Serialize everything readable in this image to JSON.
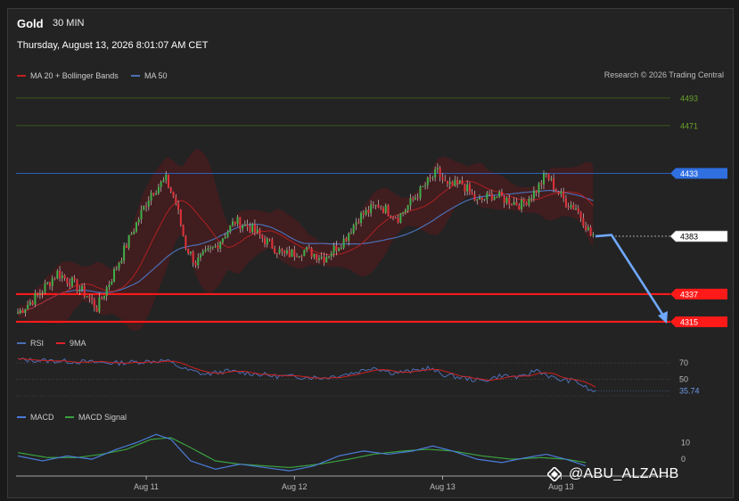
{
  "header": {
    "symbol": "Gold",
    "timeframe": "30 MIN",
    "datetime": "Thursday, August 13, 2026 8:01:07 AM CET"
  },
  "legend": {
    "ma20_bb": "MA 20 + Bollinger Bands",
    "ma50": "MA 50",
    "rsi": "RSI",
    "rsi_ma": "9MA",
    "macd": "MACD",
    "macd_signal": "MACD Signal"
  },
  "research": "Research © 2026 Trading Central",
  "watermark": "@ABU_ALZAHB",
  "colors": {
    "up": "#3fae49",
    "down": "#e0323b",
    "ma50": "#4a6fb5",
    "ma20": "#b02020",
    "rsi": "#4a6fb5",
    "macd": "#4a7cd9",
    "signal": "#3aa040",
    "support": "#ff1a1a",
    "resistance_blue": "#2f6fe0",
    "resistance_green": "#5a9a2a"
  },
  "chart_data": {
    "type": "candlestick",
    "price_axis_labels": [
      "4493",
      "4471",
      "4433",
      "4383",
      "4337",
      "4315"
    ],
    "levels": [
      {
        "value": 4493,
        "label": "4493",
        "kind": "resistance-green"
      },
      {
        "value": 4471,
        "label": "4471",
        "kind": "resistance-green"
      },
      {
        "value": 4433,
        "label": "4433",
        "kind": "resistance-blue"
      },
      {
        "value": 4383,
        "label": "4383",
        "kind": "current"
      },
      {
        "value": 4337,
        "label": "4337",
        "kind": "support"
      },
      {
        "value": 4315,
        "label": "4315",
        "kind": "support"
      }
    ],
    "price_range": [
      4310,
      4500
    ],
    "price_keypoints": [
      [
        0,
        4322
      ],
      [
        8,
        4336
      ],
      [
        16,
        4354
      ],
      [
        22,
        4346
      ],
      [
        28,
        4336
      ],
      [
        32,
        4326
      ],
      [
        38,
        4350
      ],
      [
        46,
        4385
      ],
      [
        54,
        4418
      ],
      [
        60,
        4428
      ],
      [
        64,
        4410
      ],
      [
        68,
        4375
      ],
      [
        72,
        4362
      ],
      [
        80,
        4375
      ],
      [
        88,
        4395
      ],
      [
        94,
        4390
      ],
      [
        100,
        4380
      ],
      [
        108,
        4368
      ],
      [
        116,
        4372
      ],
      [
        124,
        4366
      ],
      [
        132,
        4380
      ],
      [
        138,
        4398
      ],
      [
        146,
        4408
      ],
      [
        154,
        4398
      ],
      [
        160,
        4412
      ],
      [
        166,
        4426
      ],
      [
        170,
        4434
      ],
      [
        174,
        4422
      ],
      [
        180,
        4425
      ],
      [
        186,
        4410
      ],
      [
        192,
        4416
      ],
      [
        198,
        4412
      ],
      [
        204,
        4408
      ],
      [
        210,
        4420
      ],
      [
        214,
        4432
      ],
      [
        218,
        4420
      ],
      [
        222,
        4410
      ],
      [
        226,
        4406
      ],
      [
        230,
        4392
      ],
      [
        232,
        4384
      ]
    ],
    "x_tick_labels": [
      {
        "index": 52,
        "label": "Aug 11"
      },
      {
        "index": 112,
        "label": "Aug 12"
      },
      {
        "index": 172,
        "label": "Aug 13"
      },
      {
        "index": 220,
        "label": "Aug 13"
      }
    ],
    "forecast_arrow": {
      "from": 4383,
      "via": 4384,
      "to": 4315
    },
    "rsi": {
      "range": [
        30,
        80
      ],
      "levels": [
        70,
        50
      ],
      "current_label": "35.74",
      "keypoints": [
        [
          0,
          74
        ],
        [
          20,
          72
        ],
        [
          40,
          70
        ],
        [
          52,
          72
        ],
        [
          60,
          73
        ],
        [
          68,
          62
        ],
        [
          76,
          56
        ],
        [
          84,
          60
        ],
        [
          96,
          57
        ],
        [
          104,
          54
        ],
        [
          116,
          53
        ],
        [
          124,
          52
        ],
        [
          136,
          58
        ],
        [
          144,
          65
        ],
        [
          152,
          58
        ],
        [
          160,
          60
        ],
        [
          166,
          64
        ],
        [
          172,
          56
        ],
        [
          180,
          52
        ],
        [
          188,
          48
        ],
        [
          196,
          55
        ],
        [
          204,
          52
        ],
        [
          210,
          62
        ],
        [
          218,
          50
        ],
        [
          226,
          48
        ],
        [
          232,
          36
        ],
        [
          234,
          35.74
        ]
      ]
    },
    "macd": {
      "range": [
        -8,
        20
      ],
      "tick_labels": [
        "10",
        "0"
      ],
      "macd_keypoints": [
        [
          0,
          2
        ],
        [
          10,
          -1
        ],
        [
          20,
          2
        ],
        [
          30,
          0
        ],
        [
          40,
          6
        ],
        [
          48,
          10
        ],
        [
          56,
          15
        ],
        [
          62,
          12
        ],
        [
          70,
          -1
        ],
        [
          80,
          -6
        ],
        [
          90,
          -3
        ],
        [
          100,
          -5
        ],
        [
          110,
          -7
        ],
        [
          120,
          -4
        ],
        [
          130,
          2
        ],
        [
          140,
          5
        ],
        [
          150,
          3
        ],
        [
          160,
          5
        ],
        [
          168,
          8
        ],
        [
          176,
          5
        ],
        [
          186,
          0
        ],
        [
          196,
          -2
        ],
        [
          206,
          1
        ],
        [
          214,
          3
        ],
        [
          222,
          0
        ],
        [
          230,
          -4
        ]
      ],
      "signal_keypoints": [
        [
          0,
          4
        ],
        [
          12,
          1
        ],
        [
          24,
          1
        ],
        [
          34,
          3
        ],
        [
          44,
          6
        ],
        [
          54,
          12
        ],
        [
          62,
          13
        ],
        [
          70,
          7
        ],
        [
          80,
          -1
        ],
        [
          90,
          -3
        ],
        [
          100,
          -4
        ],
        [
          110,
          -5
        ],
        [
          122,
          -3
        ],
        [
          134,
          0
        ],
        [
          144,
          3
        ],
        [
          156,
          5
        ],
        [
          166,
          6
        ],
        [
          176,
          5
        ],
        [
          188,
          2
        ],
        [
          200,
          0
        ],
        [
          212,
          1
        ],
        [
          222,
          0
        ],
        [
          230,
          -2
        ]
      ]
    }
  }
}
